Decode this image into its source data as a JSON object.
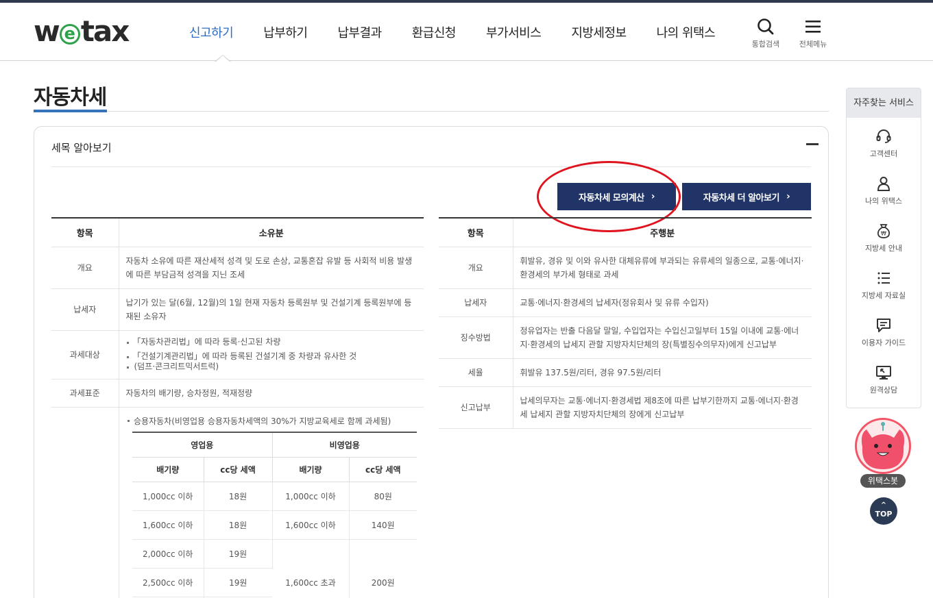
{
  "header": {
    "logo_pre": "w",
    "logo_e": "e",
    "logo_post": "tax",
    "nav": [
      "신고하기",
      "납부하기",
      "납부결과",
      "환급신청",
      "부가서비스",
      "지방세정보",
      "나의 위택스"
    ],
    "search_label": "통합검색",
    "menu_label": "전체메뉴"
  },
  "page": {
    "title": "자동차세"
  },
  "panel": {
    "title": "세목 알아보기",
    "btn_simulate": "자동차세 모의계산",
    "btn_more": "자동차세 더 알아보기"
  },
  "left_table": {
    "col_item": "항목",
    "col_title": "소유분",
    "rows": [
      {
        "label": "개요",
        "text": "자동차 소유에 따른 재산세적 성격 및 도로 손상, 교통혼잡 유발 등 사회적 비용 발생에 따른 부담금적 성격을 지닌 조세"
      },
      {
        "label": "납세자",
        "text": "납기가 있는 달(6월, 12월)의 1일 현재 자동차 등록원부 및 건설기계 등록원부에 등재된 소유자"
      },
      {
        "label": "과세대상",
        "b1": "「자동차관리법」에 따라 등록·신고된 차량",
        "b2": "「건설기계관리법」에 따라 등록된 건설기계 중 차량과 유사한 것",
        "b2_sub": "(덤프·콘크리트믹서트럭)"
      },
      {
        "label": "과세표준",
        "text": "자동차의 배기량, 승차정원, 적재정량"
      }
    ],
    "note": "승용자동차(비영업용 승용자동차세액의 30%가 지방교육세로 함께 과세됨)"
  },
  "inner_table": {
    "group_business": "영업용",
    "group_nonbusiness": "비영업용",
    "col_cc": "배기량",
    "col_tax": "cc당 세액",
    "rows": [
      [
        "1,000cc 이하",
        "18원",
        "1,000cc 이하",
        "80원"
      ],
      [
        "1,600cc 이하",
        "18원",
        "1,600cc 이하",
        "140원"
      ],
      [
        "2,000cc 이하",
        "19원",
        "1,600cc 초과",
        "200원"
      ],
      [
        "2,500cc 이하",
        "19원"
      ]
    ]
  },
  "right_table": {
    "col_item": "항목",
    "col_title": "주행분",
    "rows": [
      {
        "label": "개요",
        "text": "휘발유, 경유 및 이와 유사한 대체유류에 부과되는 유류세의 일종으로, 교통·에너지·환경세의 부가세 형태로 과세"
      },
      {
        "label": "납세자",
        "text": "교통·에너지·환경세의 납세자(정유회사 및 유류 수입자)"
      },
      {
        "label": "징수방법",
        "text": "정유업자는 반출 다음달 말일, 수입업자는 수입신고일부터 15일 이내에 교통·에너지·환경세의 납세지 관할 지방자치단체의 장(특별징수의무자)에게 신고납부"
      },
      {
        "label": "세율",
        "text": "휘발유 137.5원/리터, 경유 97.5원/리터"
      },
      {
        "label": "신고납부",
        "text": "납세의무자는 교통·에너지·환경세법 제8조에 따른 납부기한까지 교통·에너지·환경세 납세지 관할 지방자치단체의 장에게 신고납부"
      }
    ]
  },
  "quick": {
    "title": "자주찾는 서비스",
    "items": [
      "고객센터",
      "나의 위택스",
      "지방세 안내",
      "지방세 자료실",
      "이용자 가이드",
      "원격상담"
    ]
  },
  "bot": {
    "label": "위택스봇"
  },
  "top_btn": {
    "label": "TOP"
  },
  "colors": {
    "navy": "#213468",
    "active_nav": "#2b6cc4",
    "logo_green": "#2ea24b",
    "annotation_red": "#e0141e"
  }
}
